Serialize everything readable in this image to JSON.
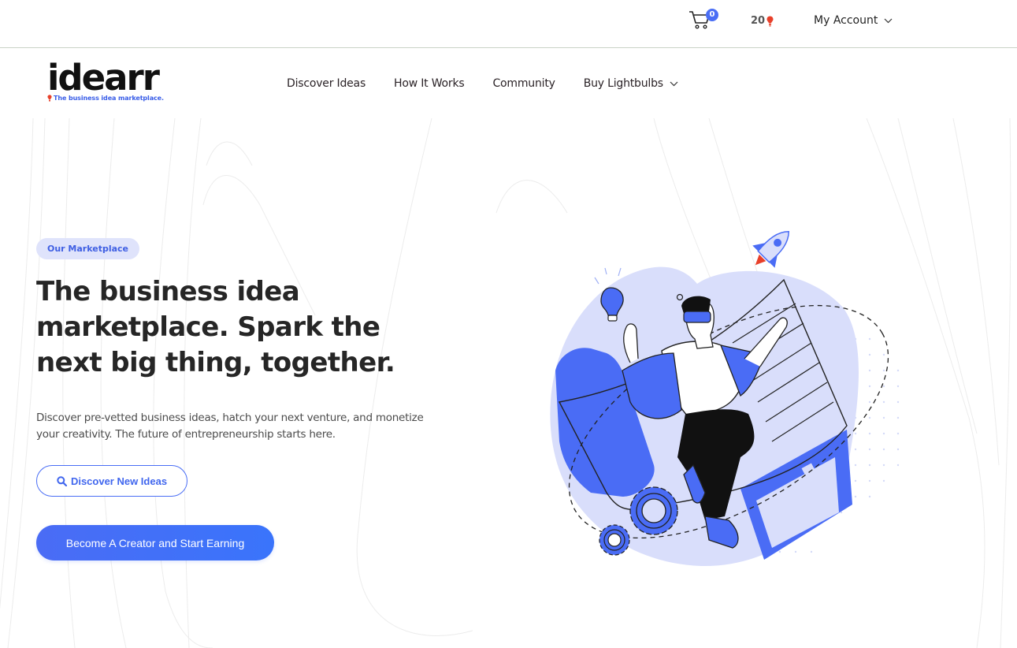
{
  "topbar": {
    "cart": {
      "icon": "cart-icon",
      "count": "0"
    },
    "lightbulbs": {
      "count": "20",
      "icon": "lightbulb-icon"
    },
    "account": {
      "label": "My Account",
      "icon": "chevron-down-icon"
    }
  },
  "header": {
    "logo": {
      "wordmark": "idearr",
      "tagline": "The business idea marketplace."
    },
    "nav": [
      {
        "label": "Discover Ideas"
      },
      {
        "label": "How It Works"
      },
      {
        "label": "Community"
      },
      {
        "label": "Buy Lightbulbs",
        "has_dropdown": true
      }
    ]
  },
  "hero": {
    "badge": "Our Marketplace",
    "headline": "The business idea marketplace. Spark the next big thing, together.",
    "subtext": "Discover pre-vetted business ideas, hatch your next venture, and monetize your creativity. The future of entrepreneurship starts here.",
    "secondary_button": {
      "label": "Discover New Ideas",
      "icon": "search-icon"
    },
    "primary_button": {
      "label": "Become A Creator and Start Earning"
    },
    "illustration": "person-with-vr-headset-lightbulb-rocket-gears-illustration"
  },
  "colors": {
    "brand_blue": "#4a6ef5",
    "badge_bg": "#dfe3fb",
    "bulb_red": "#e8402a",
    "heading": "#262626",
    "illustration_light": "#d9defb"
  }
}
